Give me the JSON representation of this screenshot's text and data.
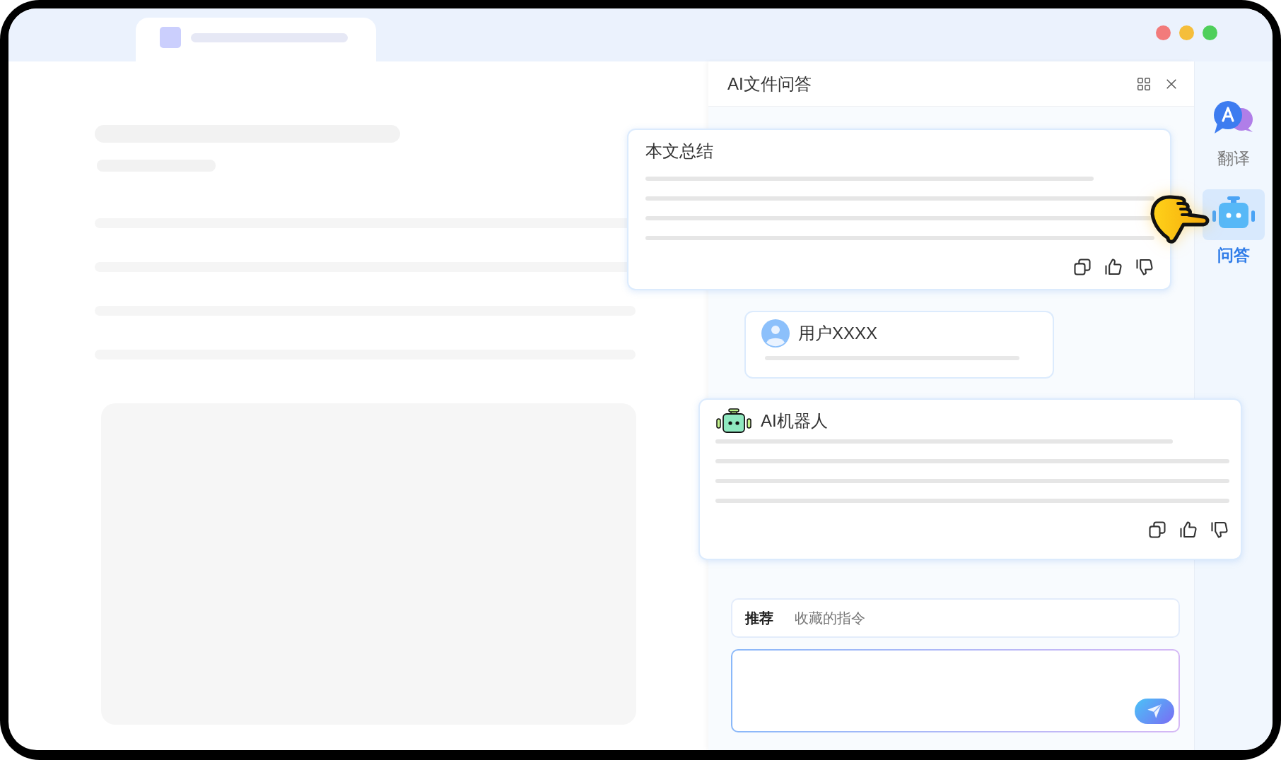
{
  "panel": {
    "title": "AI文件问答"
  },
  "summary_card": {
    "title": "本文总结"
  },
  "user_card": {
    "name": "用户XXXX"
  },
  "bot_card": {
    "name": "AI机器人"
  },
  "command_tabs": [
    {
      "label": "推荐",
      "selected": true
    },
    {
      "label": "收藏的指令",
      "selected": false
    }
  ],
  "sidebar": {
    "items": [
      {
        "label": "翻译",
        "kind": "translate",
        "selected": false
      },
      {
        "label": "问答",
        "kind": "robot",
        "selected": true
      }
    ]
  }
}
